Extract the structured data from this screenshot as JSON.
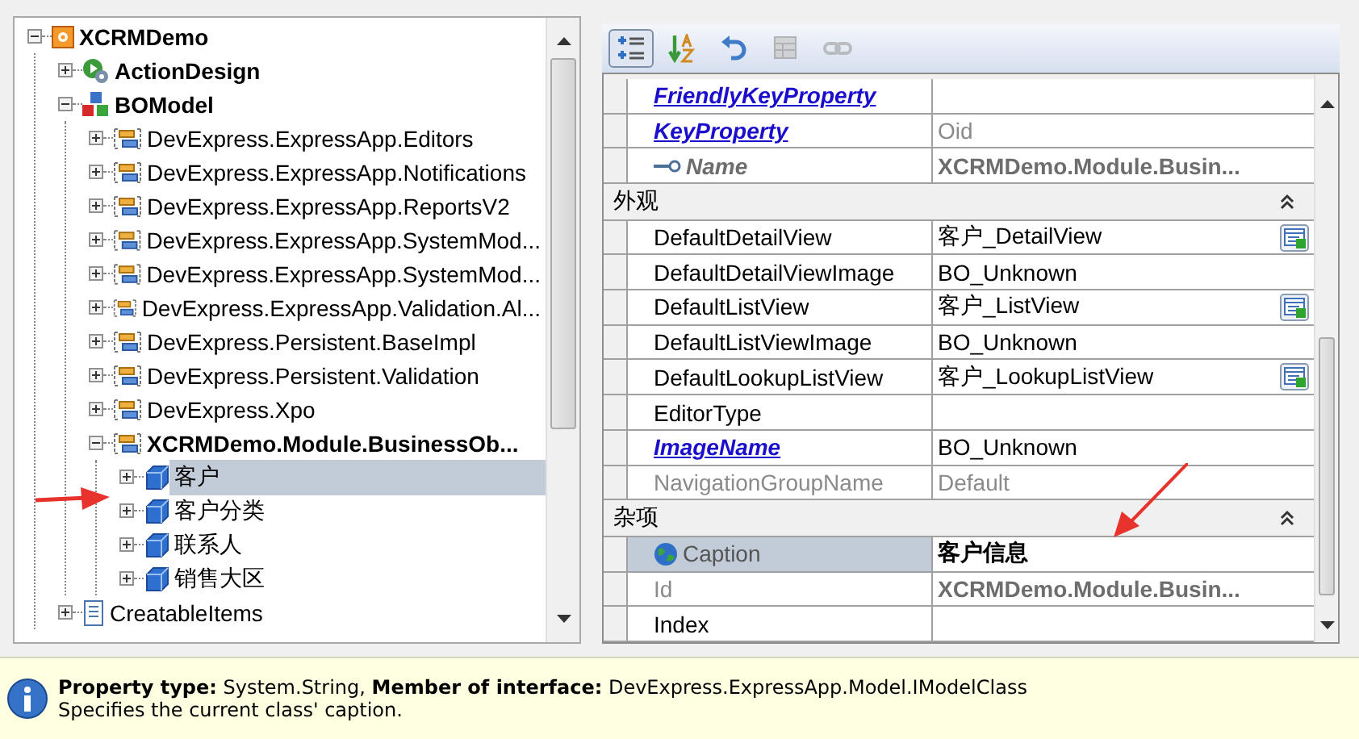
{
  "tree": {
    "nodes": [
      {
        "label": "XCRMDemo",
        "kind": "project",
        "bold": true,
        "expanded": true,
        "selected": false,
        "children": [
          {
            "label": "ActionDesign",
            "kind": "actions",
            "bold": true,
            "expanded": false,
            "selected": false
          },
          {
            "label": "BOModel",
            "kind": "model",
            "bold": true,
            "expanded": true,
            "selected": false,
            "children": [
              {
                "label": "DevExpress.ExpressApp.Editors",
                "kind": "namespace",
                "bold": false,
                "expanded": false,
                "selected": false
              },
              {
                "label": "DevExpress.ExpressApp.Notifications",
                "kind": "namespace",
                "bold": false,
                "expanded": false,
                "selected": false
              },
              {
                "label": "DevExpress.ExpressApp.ReportsV2",
                "kind": "namespace",
                "bold": false,
                "expanded": false,
                "selected": false
              },
              {
                "label": "DevExpress.ExpressApp.SystemMod...",
                "kind": "namespace",
                "bold": false,
                "expanded": false,
                "selected": false
              },
              {
                "label": "DevExpress.ExpressApp.SystemMod...",
                "kind": "namespace",
                "bold": false,
                "expanded": false,
                "selected": false
              },
              {
                "label": "DevExpress.ExpressApp.Validation.Al...",
                "kind": "namespace",
                "bold": false,
                "expanded": false,
                "selected": false
              },
              {
                "label": "DevExpress.Persistent.BaseImpl",
                "kind": "namespace",
                "bold": false,
                "expanded": false,
                "selected": false
              },
              {
                "label": "DevExpress.Persistent.Validation",
                "kind": "namespace",
                "bold": false,
                "expanded": false,
                "selected": false
              },
              {
                "label": "DevExpress.Xpo",
                "kind": "namespace",
                "bold": false,
                "expanded": false,
                "selected": false
              },
              {
                "label": "XCRMDemo.Module.BusinessOb...",
                "kind": "namespace",
                "bold": true,
                "expanded": true,
                "selected": false,
                "children": [
                  {
                    "label": "客户",
                    "kind": "class",
                    "bold": false,
                    "expanded": false,
                    "selected": true
                  },
                  {
                    "label": "客户分类",
                    "kind": "class",
                    "bold": false,
                    "expanded": false,
                    "selected": false
                  },
                  {
                    "label": "联系人",
                    "kind": "class",
                    "bold": false,
                    "expanded": false,
                    "selected": false
                  },
                  {
                    "label": "销售大区",
                    "kind": "class",
                    "bold": false,
                    "expanded": false,
                    "selected": false
                  }
                ]
              }
            ]
          },
          {
            "label": "CreatableItems",
            "kind": "list",
            "bold": false,
            "expanded": false,
            "selected": false
          }
        ]
      }
    ]
  },
  "toolbar": [
    {
      "kind": "categorized",
      "selected": true,
      "disabled": false
    },
    {
      "kind": "sort",
      "selected": false,
      "disabled": false
    },
    {
      "kind": "undo",
      "selected": false,
      "disabled": false
    },
    {
      "kind": "grid",
      "selected": false,
      "disabled": true
    },
    {
      "kind": "link",
      "selected": false,
      "disabled": true
    }
  ],
  "properties": [
    {
      "kind": "row",
      "name": "FriendlyKeyProperty",
      "link": true,
      "key": false,
      "localized": false,
      "disabled": false,
      "lookup": false,
      "selected": false
    },
    {
      "kind": "row",
      "name": "KeyProperty",
      "link": true,
      "key": false,
      "localized": false,
      "disabled": false,
      "value": "Oid",
      "value_bold": false,
      "value_disabled": true,
      "lookup": false,
      "selected": false
    },
    {
      "kind": "row",
      "name": "Name",
      "link": false,
      "key": true,
      "localized": false,
      "disabled": false,
      "value": "XCRMDemo.Module.Busin...",
      "value_bold": true,
      "value_disabled": true,
      "lookup": false,
      "selected": false
    },
    {
      "kind": "category",
      "name": "外观",
      "expanded": true
    },
    {
      "kind": "row",
      "name": "DefaultDetailView",
      "link": false,
      "key": false,
      "localized": false,
      "disabled": false,
      "value": "客户_DetailView",
      "value_bold": false,
      "value_disabled": false,
      "lookup": true,
      "selected": false
    },
    {
      "kind": "row",
      "name": "DefaultDetailViewImage",
      "link": false,
      "key": false,
      "localized": false,
      "disabled": false,
      "value": "BO_Unknown",
      "value_bold": false,
      "value_disabled": false,
      "lookup": false,
      "selected": false
    },
    {
      "kind": "row",
      "name": "DefaultListView",
      "link": false,
      "key": false,
      "localized": false,
      "disabled": false,
      "value": "客户_ListView",
      "value_bold": false,
      "value_disabled": false,
      "lookup": true,
      "selected": false
    },
    {
      "kind": "row",
      "name": "DefaultListViewImage",
      "link": false,
      "key": false,
      "localized": false,
      "disabled": false,
      "value": "BO_Unknown",
      "value_bold": false,
      "value_disabled": false,
      "lookup": false,
      "selected": false
    },
    {
      "kind": "row",
      "name": "DefaultLookupListView",
      "link": false,
      "key": false,
      "localized": false,
      "disabled": false,
      "value": "客户_LookupListView",
      "value_bold": false,
      "value_disabled": false,
      "lookup": true,
      "selected": false
    },
    {
      "kind": "row",
      "name": "EditorType",
      "link": false,
      "key": false,
      "localized": false,
      "disabled": false,
      "lookup": false,
      "selected": false
    },
    {
      "kind": "row",
      "name": "ImageName",
      "link": true,
      "key": false,
      "localized": false,
      "disabled": false,
      "value": "BO_Unknown",
      "value_bold": false,
      "value_disabled": false,
      "lookup": false,
      "selected": false
    },
    {
      "kind": "row",
      "name": "NavigationGroupName",
      "link": false,
      "key": false,
      "localized": false,
      "disabled": true,
      "value": "Default",
      "value_bold": false,
      "value_disabled": true,
      "lookup": false,
      "selected": false
    },
    {
      "kind": "category",
      "name": "杂项",
      "expanded": true
    },
    {
      "kind": "row",
      "name": "Caption",
      "link": false,
      "key": false,
      "localized": true,
      "disabled": false,
      "value": "客户信息",
      "value_bold": true,
      "value_disabled": false,
      "lookup": false,
      "selected": true
    },
    {
      "kind": "row",
      "name": "Id",
      "link": false,
      "key": false,
      "localized": false,
      "disabled": true,
      "value": "XCRMDemo.Module.Busin...",
      "value_bold": true,
      "value_disabled": true,
      "lookup": false,
      "selected": false
    },
    {
      "kind": "row",
      "name": "Index",
      "link": false,
      "key": false,
      "localized": false,
      "disabled": false,
      "lookup": false,
      "selected": false
    }
  ],
  "info": {
    "line": "**Property type:** System.String, **Member of interface:** DevExpress.ExpressApp.Model.IModelClass",
    "description": "Specifies the current class' caption."
  }
}
